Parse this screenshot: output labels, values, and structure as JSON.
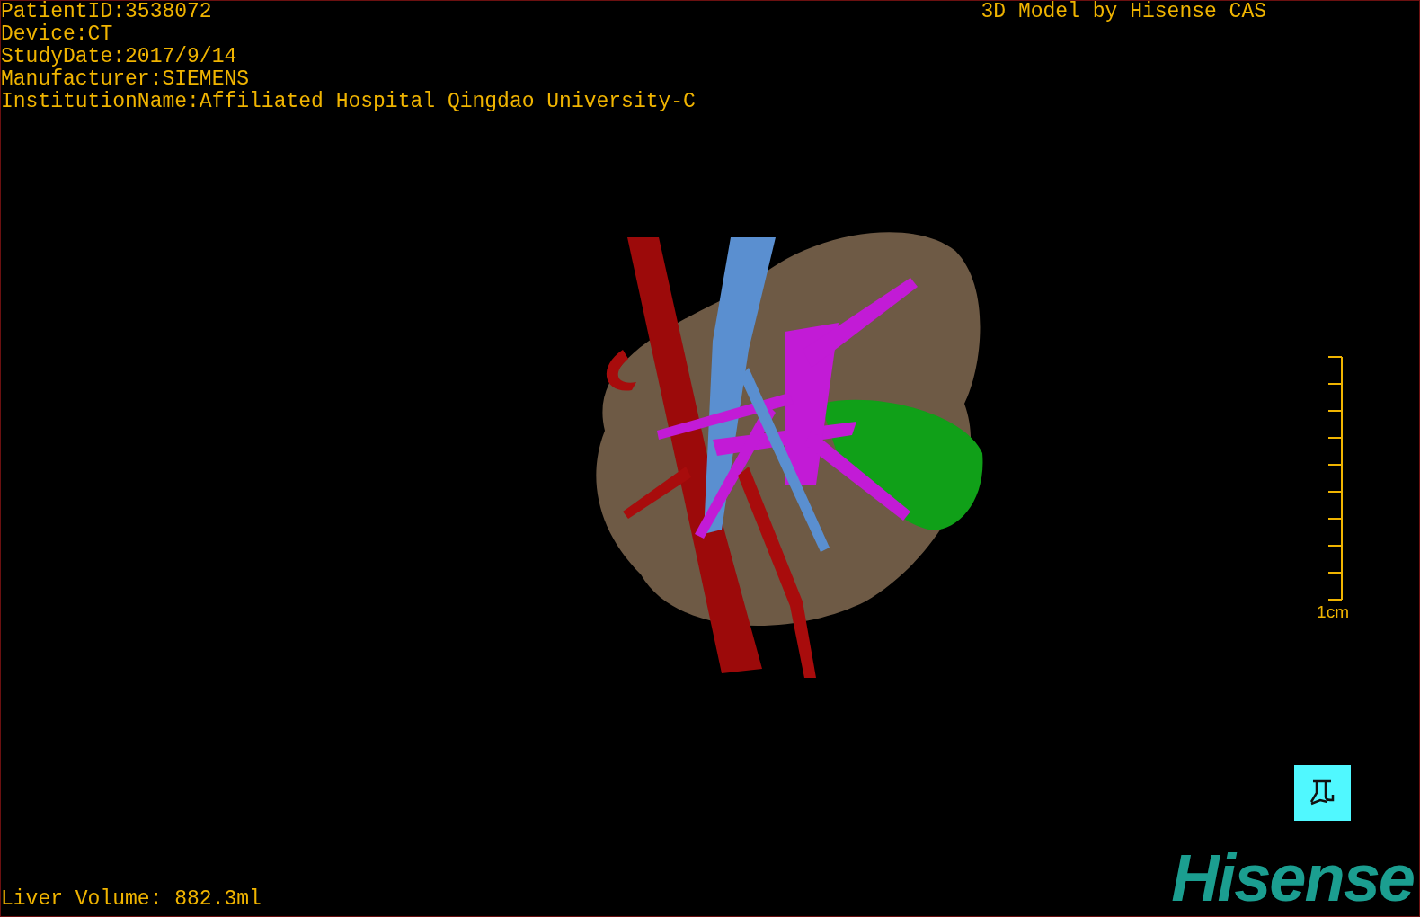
{
  "info_lines": [
    "PatientID:3538072",
    "Device:CT",
    "StudyDate:2017/9/14",
    "Manufacturer:SIEMENS",
    "InstitutionName:Affiliated Hospital Qingdao University-C"
  ],
  "title": "3D Model by Hisense CAS",
  "scale_bar": {
    "label": "1cm"
  },
  "liver_volume": "Liver Volume: 882.3ml",
  "logo": "Hisense"
}
